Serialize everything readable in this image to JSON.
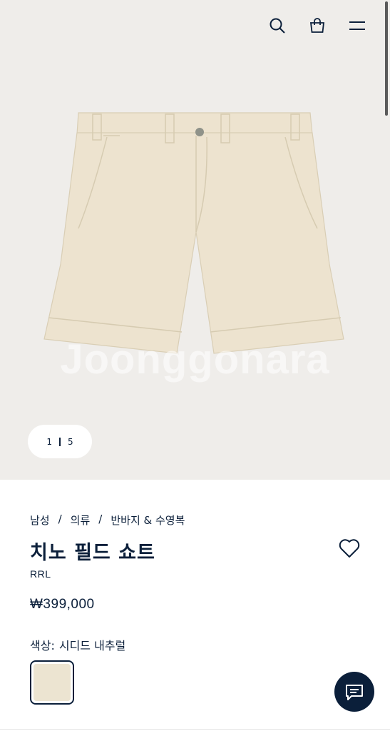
{
  "header": {
    "icons": [
      "search-icon",
      "shopping-bag-icon",
      "menu-icon"
    ]
  },
  "gallery": {
    "watermark": "Joonggonara",
    "pager_current": "1",
    "pager_total": "5"
  },
  "product": {
    "breadcrumb": [
      "남성",
      "의류",
      "반바지 & 수영복"
    ],
    "breadcrumb_sep": "/",
    "title": "치노 필드 쇼트",
    "brand": "RRL",
    "price": "₩399,000",
    "color_label": "색상:",
    "color_value": "시디드 내추럴",
    "swatch_color": "#ece4d1"
  },
  "colors": {
    "navy": "#0b1f3a",
    "hero_bg": "#efedea",
    "shorts": "#ede3cf"
  }
}
